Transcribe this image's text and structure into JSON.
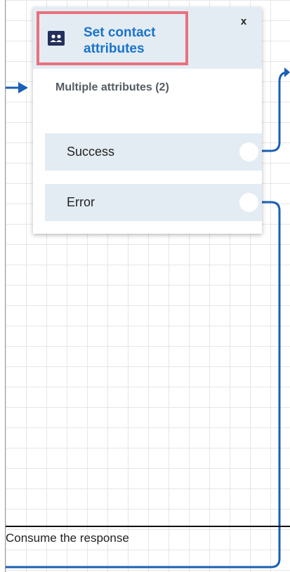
{
  "block": {
    "title": "Set contact attributes",
    "subtitle": "Multiple attributes (2)",
    "close_label": "x",
    "icon": "contact-card-icon",
    "highlight_color": "#e9707d",
    "accent_color": "#1a73c9"
  },
  "branches": [
    {
      "label": "Success"
    },
    {
      "label": "Error"
    }
  ],
  "footer": {
    "text": "Consume the response"
  },
  "connector_color": "#1a5fb4"
}
